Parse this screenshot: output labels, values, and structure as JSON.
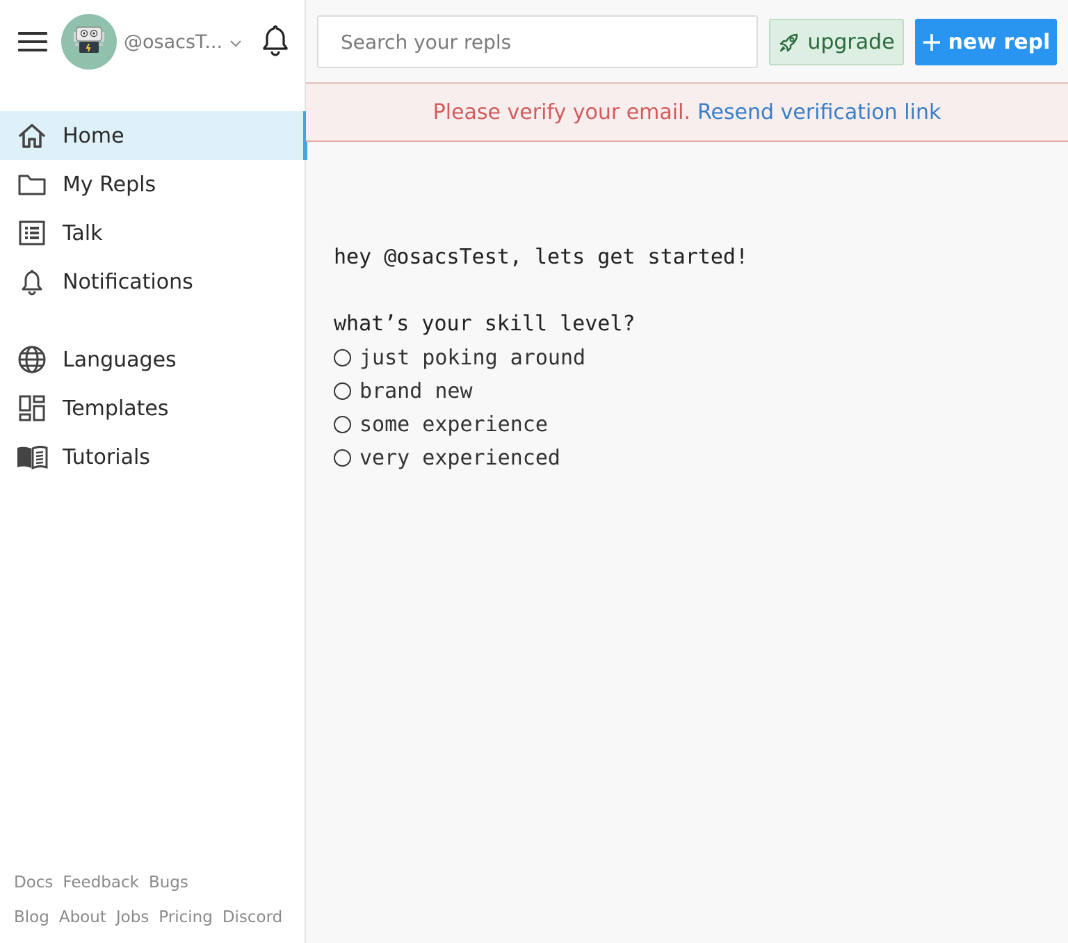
{
  "sidebar": {
    "username": "@osacsT...",
    "nav_primary": [
      {
        "label": "Home",
        "icon": "home-icon",
        "active": true
      },
      {
        "label": "My Repls",
        "icon": "folder-icon"
      },
      {
        "label": "Talk",
        "icon": "list-icon"
      },
      {
        "label": "Notifications",
        "icon": "bell-icon"
      }
    ],
    "nav_secondary": [
      {
        "label": "Languages",
        "icon": "globe-icon"
      },
      {
        "label": "Templates",
        "icon": "templates-icon"
      },
      {
        "label": "Tutorials",
        "icon": "book-icon"
      }
    ],
    "footer": {
      "row1": [
        "Docs",
        "Feedback",
        "Bugs"
      ],
      "row2": [
        "Blog",
        "About",
        "Jobs",
        "Pricing",
        "Discord"
      ]
    }
  },
  "header": {
    "search_placeholder": "Search your repls",
    "upgrade_label": "upgrade",
    "new_repl_label": "new repl"
  },
  "banner": {
    "message": "Please verify your email.",
    "link": "Resend verification link"
  },
  "main": {
    "greeting": "hey @osacsTest, lets get started!",
    "question": "what’s your skill level?",
    "options": [
      "just poking around",
      "brand new",
      "some experience",
      "very experienced"
    ]
  },
  "colors": {
    "accent": "#3ba8e0",
    "active_bg": "#dff1f8",
    "new_repl_bg": "#2a95f1",
    "upgrade_bg": "#dcefe2",
    "upgrade_text": "#2a6a3e",
    "banner_bg": "#f9eeee",
    "banner_warn": "#d25c5c",
    "banner_link": "#3a7ec6",
    "avatar_bg": "#8fc1ad"
  }
}
